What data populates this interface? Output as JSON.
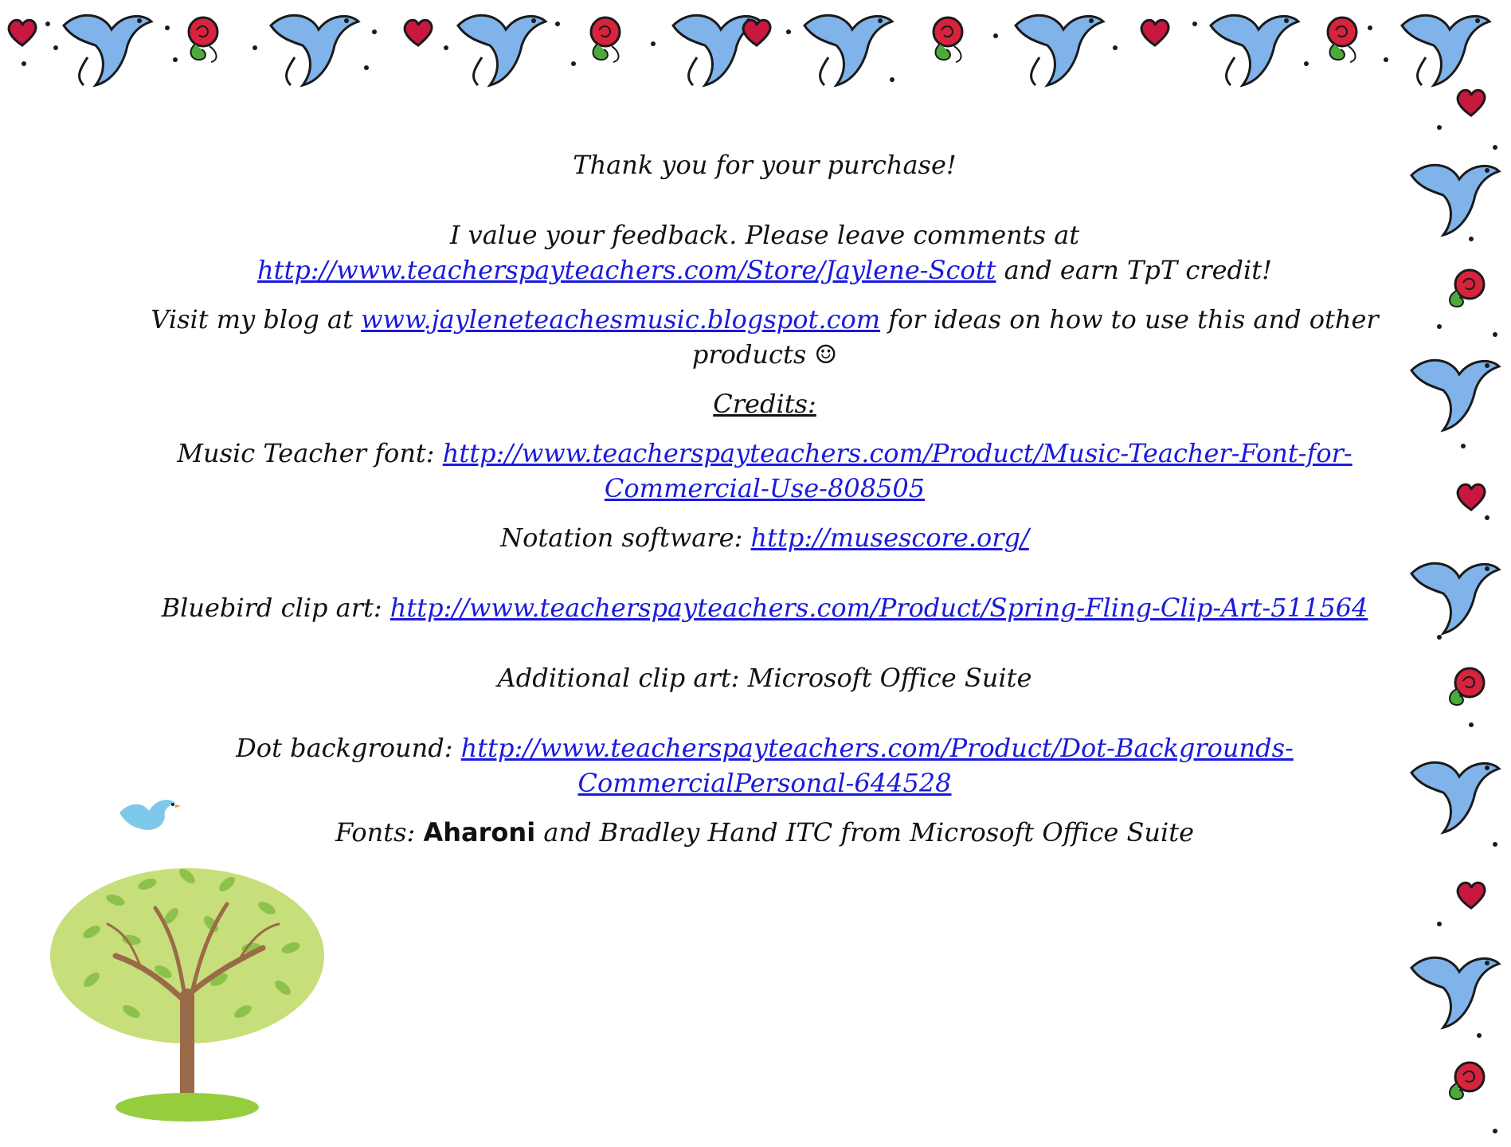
{
  "thanks": "Thank you for your purchase!",
  "feedback": {
    "prefix": "I value your feedback.  Please leave comments at ",
    "link": "http://www.teacherspayteachers.com/Store/Jaylene-Scott",
    "suffix": " and earn TpT credit!"
  },
  "blog": {
    "prefix": "Visit my blog at ",
    "link": "www.jayleneteachesmusic.blogspot.com",
    "suffix": " for ideas on how to use this and other products ☺"
  },
  "credits_heading": "Credits:",
  "credits": {
    "music_font_label": "Music Teacher font:  ",
    "music_font_link": "http://www.teacherspayteachers.com/Product/Music-Teacher-Font-for-Commercial-Use-808505",
    "notation_label": "Notation software:  ",
    "notation_link": "http://musescore.org/",
    "bluebird_label": "Bluebird clip art:  ",
    "bluebird_link": "http://www.teacherspayteachers.com/Product/Spring-Fling-Clip-Art-511564",
    "additional": "Additional clip art:  Microsoft Office Suite",
    "dot_label": "Dot background: ",
    "dot_link": "http://www.teacherspayteachers.com/Product/Dot-Backgrounds-CommercialPersonal-644528",
    "fonts_label": "Fonts:  ",
    "fonts_strong": "Aharoni",
    "fonts_rest": " and Bradley Hand ITC from Microsoft Office Suite"
  },
  "colors": {
    "link": "#1a1adc",
    "bird": "#7fb3ea",
    "rose": "#d8233c",
    "heart": "#c8183f",
    "leaf": "#4caa3a",
    "tree_canopy": "#c7df7a",
    "tree_leaves": "#8cc24a",
    "trunk": "#9a6b48",
    "grass": "#96cd3f"
  },
  "icons": [
    "bluebird-icon",
    "rose-icon",
    "heart-icon",
    "tree-icon"
  ]
}
